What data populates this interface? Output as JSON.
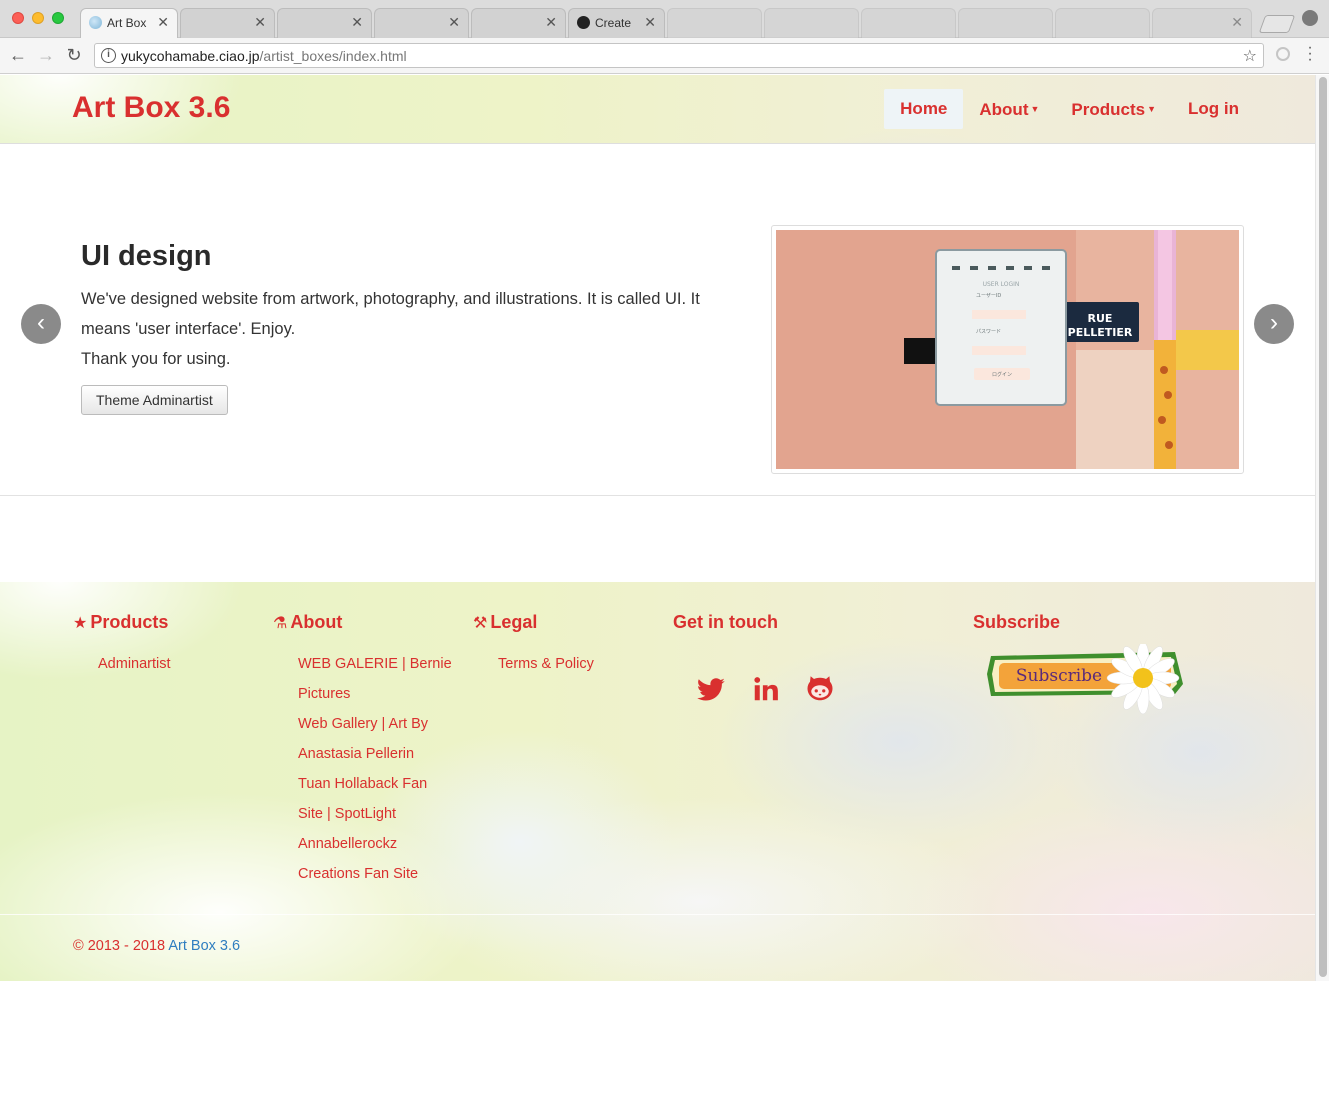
{
  "browser": {
    "tabs": [
      {
        "label": "Art Box",
        "active": true
      },
      {
        "label": "",
        "active": false
      },
      {
        "label": "",
        "active": false
      },
      {
        "label": "",
        "active": false
      },
      {
        "label": "",
        "active": false
      },
      {
        "label": "Create",
        "active": false
      }
    ],
    "url_host": "yukycohamabe.ciao.jp",
    "url_path": "/artist_boxes/index.html"
  },
  "header": {
    "brand": "Art Box 3.6",
    "nav": [
      {
        "label": "Home",
        "active": true,
        "dropdown": false
      },
      {
        "label": "About",
        "active": false,
        "dropdown": true
      },
      {
        "label": "Products",
        "active": false,
        "dropdown": true
      },
      {
        "label": "Log in",
        "active": false,
        "dropdown": false
      }
    ]
  },
  "carousel": {
    "title": "UI design",
    "text_line1": "We've designed website from artwork, photography, and illustrations. It is called UI. It means 'user interface'. Enjoy.",
    "text_line2": "Thank you for using.",
    "button_label": "Theme Adminartist",
    "prev_label": "‹",
    "next_label": "›",
    "image": {
      "login_title": "USER LOGIN",
      "login_user_label": "ユーザーID",
      "login_pass_label": "パスワード",
      "login_button": "ログイン",
      "street_sign_line1": "RUE",
      "street_sign_line2": "PELLETIER"
    }
  },
  "footer": {
    "products": {
      "heading": "Products",
      "icon": "star-icon",
      "links": [
        "Adminartist"
      ]
    },
    "about": {
      "heading": "About",
      "icon": "flask-icon",
      "links": [
        "WEB GALERIE | Bernie",
        "Pictures",
        "Web Gallery | Art By",
        "Anastasia Pellerin",
        "Tuan Hollaback Fan",
        "Site | SpotLight",
        "Annabellerockz",
        "Creations Fan Site"
      ]
    },
    "legal": {
      "heading": "Legal",
      "icon": "gavel-icon",
      "links": [
        "Terms & Policy"
      ]
    },
    "contact": {
      "heading": "Get in touch",
      "social": [
        "twitter-icon",
        "linkedin-icon",
        "github-icon"
      ]
    },
    "subscribe": {
      "heading": "Subscribe",
      "badge_label": "Subscribe"
    },
    "copyright_prefix": "© 2013 - 2018 ",
    "copyright_link": "Art Box 3.6"
  },
  "colors": {
    "brand_red": "#d9302f",
    "link_blue": "#2f7ec0"
  }
}
